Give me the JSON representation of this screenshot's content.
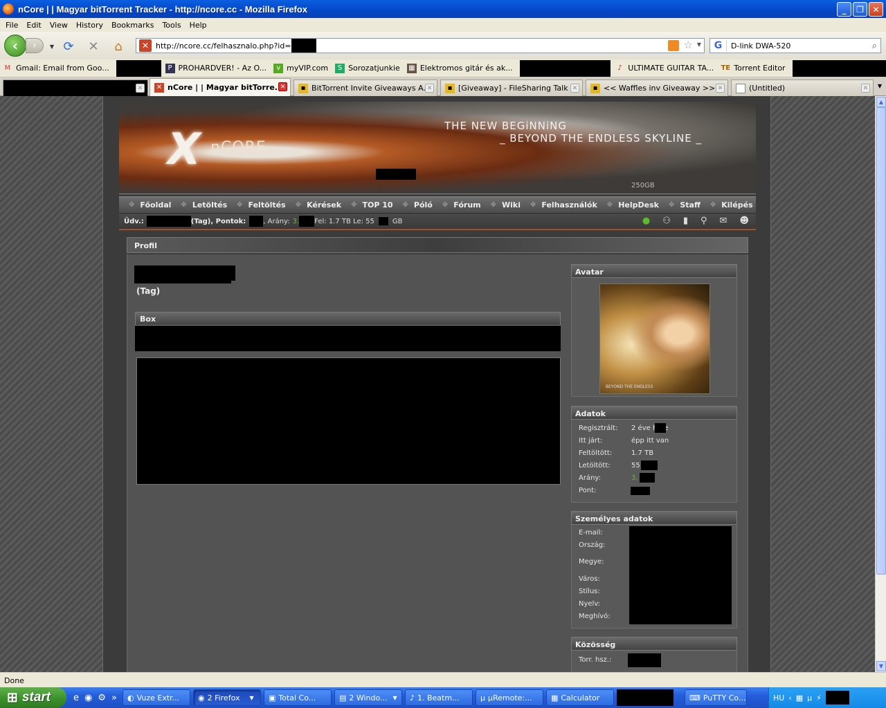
{
  "window": {
    "title": "nCore | | Magyar bitTorrent Tracker - http://ncore.cc - Mozilla Firefox"
  },
  "menu": [
    "File",
    "Edit",
    "View",
    "History",
    "Bookmarks",
    "Tools",
    "Help"
  ],
  "nav": {
    "url": "http://ncore.cc/felhasznalo.php?id=",
    "search_value": "D-link DWA-520"
  },
  "bookmarks": [
    "Gmail: Email from Goo...",
    "PROHARDVER! - Az O...",
    "myVIP.com",
    "Sorozatjunkie",
    "Elektromos gitár és ak...",
    "ULTIMATE GUITAR TA...",
    "Torrent Editor"
  ],
  "tabs": [
    "nCore | | Magyar bitTorre...",
    "BitTorrent Invite Giveaways A...",
    "[Giveaway] - FileSharing Talk",
    "<< Waffles inv Giveaway >> ...",
    "(Untitled)"
  ],
  "banner": {
    "logo_text": "nCORE",
    "slogan1": "THE NEW BEGiNNiNG",
    "slogan2": "_ BEYOND THE ENDLESS SKYLINE _",
    "small_text": "250GB"
  },
  "site_nav": [
    "Főoldal",
    "Letöltés",
    "Feltöltés",
    "Kérések",
    "TOP 10",
    "Póló",
    "Fórum",
    "Wiki",
    "Felhasználók",
    "HelpDesk",
    "Staff",
    "Kilépés"
  ],
  "statusline": {
    "greet": "Üdv.:",
    "role": "(Tag), Pontok:",
    "ratio_label": ", Arány:",
    "ratio_prefix": "3.",
    "traffic": "Fel: 1.7 TB Le: 55",
    "unit": "GB"
  },
  "profile": {
    "title": "Profil",
    "role": "(Tag)",
    "box_title": "Box",
    "avatar_title": "Avatar",
    "avatar_caption": "BEYOND THE ENDLESS",
    "stats_title": "Adatok",
    "stats": [
      {
        "label": "Regisztrált:",
        "value": "2 éve       hete"
      },
      {
        "label": "Itt járt:",
        "value": "épp itt van"
      },
      {
        "label": "Feltöltött:",
        "value": "1.7 TB"
      },
      {
        "label": "Letöltött:",
        "value": "55              GB"
      },
      {
        "label": "Arány:",
        "value": "3."
      },
      {
        "label": "Pont:",
        "value": ""
      }
    ],
    "personal_title": "Személyes adatok",
    "personal_labels": [
      "E-mail:",
      "Ország:",
      "Megye:",
      "Város:",
      "Stílus:",
      "Nyelv:",
      "Meghívó:"
    ],
    "community_title": "Közösség",
    "community_labels": [
      "Torr. hsz.:"
    ]
  },
  "status_text": "Done",
  "taskbar": {
    "start": "start",
    "items": [
      "Vuze Extr...",
      "2 Firefox",
      "Total Co...",
      "2 Windo...",
      "1. Beatm...",
      "µRemote:...",
      "Calculator",
      "PuTTY Co..."
    ],
    "lang": "HU"
  }
}
